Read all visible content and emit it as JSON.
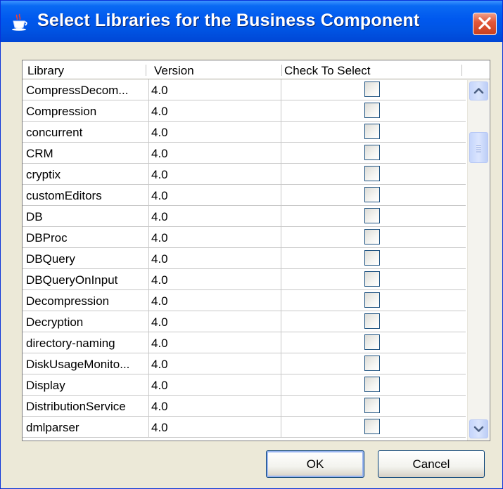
{
  "window": {
    "title": "Select Libraries for the Business Component",
    "icon": "java-coffee-cup-icon",
    "close_icon": "close-x-icon"
  },
  "table": {
    "columns": [
      "Library",
      "Version",
      "Check To Select"
    ],
    "rows": [
      {
        "library": "CompressDecom...",
        "version": "4.0",
        "checked": false
      },
      {
        "library": "Compression",
        "version": "4.0",
        "checked": false
      },
      {
        "library": "concurrent",
        "version": "4.0",
        "checked": false
      },
      {
        "library": "CRM",
        "version": "4.0",
        "checked": false
      },
      {
        "library": "cryptix",
        "version": "4.0",
        "checked": false
      },
      {
        "library": "customEditors",
        "version": "4.0",
        "checked": false
      },
      {
        "library": "DB",
        "version": "4.0",
        "checked": false
      },
      {
        "library": "DBProc",
        "version": "4.0",
        "checked": false
      },
      {
        "library": "DBQuery",
        "version": "4.0",
        "checked": false
      },
      {
        "library": "DBQueryOnInput",
        "version": "4.0",
        "checked": false
      },
      {
        "library": "Decompression",
        "version": "4.0",
        "checked": false
      },
      {
        "library": "Decryption",
        "version": "4.0",
        "checked": false
      },
      {
        "library": "directory-naming",
        "version": "4.0",
        "checked": false
      },
      {
        "library": "DiskUsageMonito...",
        "version": "4.0",
        "checked": false
      },
      {
        "library": "Display",
        "version": "4.0",
        "checked": false
      },
      {
        "library": "DistributionService",
        "version": "4.0",
        "checked": false
      },
      {
        "library": "dmlparser",
        "version": "4.0",
        "checked": false
      }
    ]
  },
  "scrollbar": {
    "up_icon": "chevron-up-icon",
    "down_icon": "chevron-down-icon",
    "grip_icon": "scroll-grip-icon"
  },
  "buttons": {
    "ok_label": "OK",
    "cancel_label": "Cancel"
  }
}
